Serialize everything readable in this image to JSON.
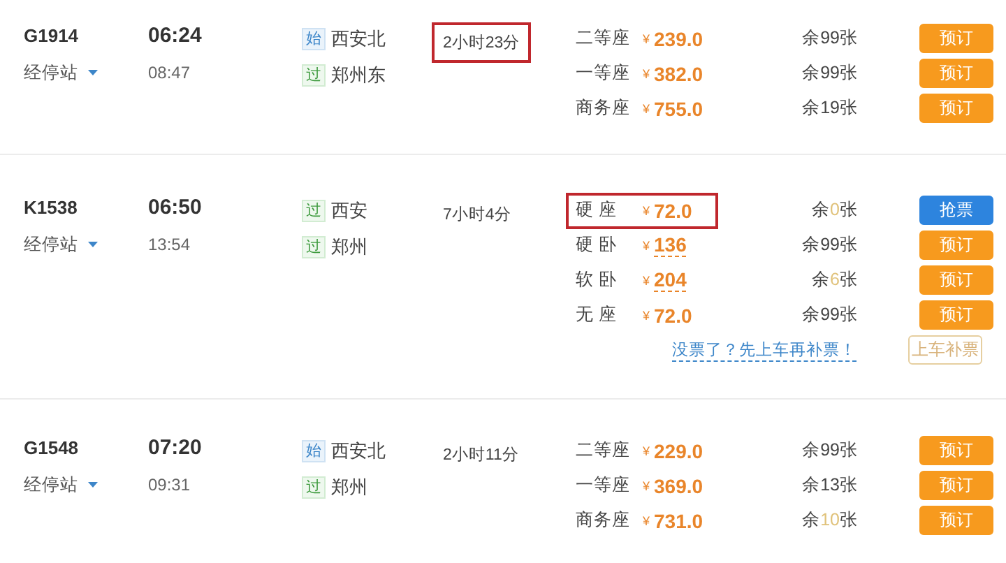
{
  "trains": [
    {
      "number": "G1914",
      "stops_label": "经停站",
      "depart": "06:24",
      "arrive": "08:47",
      "stations": [
        {
          "badge": "始",
          "kind": "start",
          "name": "西安北"
        },
        {
          "badge": "过",
          "kind": "pass",
          "name": "郑州东"
        }
      ],
      "duration": "2小时23分",
      "duration_highlighted": true,
      "seats": [
        {
          "name": "二等座",
          "currency": "¥",
          "price": "239.0",
          "underlined": false,
          "highlighted": false,
          "remaining": {
            "prefix": "余",
            "count": "99",
            "suffix": "张",
            "low": false
          },
          "button": {
            "label": "预订",
            "kind": "book"
          }
        },
        {
          "name": "一等座",
          "currency": "¥",
          "price": "382.0",
          "underlined": false,
          "highlighted": false,
          "remaining": {
            "prefix": "余",
            "count": "99",
            "suffix": "张",
            "low": false
          },
          "button": {
            "label": "预订",
            "kind": "book"
          }
        },
        {
          "name": "商务座",
          "currency": "¥",
          "price": "755.0",
          "underlined": false,
          "highlighted": false,
          "remaining": {
            "prefix": "余",
            "count": "19",
            "suffix": "张",
            "low": false
          },
          "button": {
            "label": "预订",
            "kind": "book"
          }
        }
      ]
    },
    {
      "number": "K1538",
      "stops_label": "经停站",
      "depart": "06:50",
      "arrive": "13:54",
      "stations": [
        {
          "badge": "过",
          "kind": "pass",
          "name": "西安"
        },
        {
          "badge": "过",
          "kind": "pass",
          "name": "郑州"
        }
      ],
      "duration": "7小时4分",
      "duration_highlighted": false,
      "seats": [
        {
          "name": "硬 座",
          "currency": "¥",
          "price": "72.0",
          "underlined": false,
          "highlighted": true,
          "remaining": {
            "prefix": "余",
            "count": "0",
            "suffix": "张",
            "low": true
          },
          "button": {
            "label": "抢票",
            "kind": "grab"
          }
        },
        {
          "name": "硬 卧",
          "currency": "¥",
          "price": "136",
          "underlined": true,
          "highlighted": false,
          "remaining": {
            "prefix": "余",
            "count": "99",
            "suffix": "张",
            "low": false
          },
          "button": {
            "label": "预订",
            "kind": "book"
          }
        },
        {
          "name": "软 卧",
          "currency": "¥",
          "price": "204",
          "underlined": true,
          "highlighted": false,
          "remaining": {
            "prefix": "余",
            "count": "6",
            "suffix": "张",
            "low": true
          },
          "button": {
            "label": "预订",
            "kind": "book"
          }
        },
        {
          "name": "无 座",
          "currency": "¥",
          "price": "72.0",
          "underlined": false,
          "highlighted": false,
          "remaining": {
            "prefix": "余",
            "count": "99",
            "suffix": "张",
            "low": false
          },
          "button": {
            "label": "预订",
            "kind": "book"
          }
        }
      ],
      "extra": {
        "link": "没票了？先上车再补票！",
        "button": {
          "label": "上车补票",
          "kind": "board"
        }
      }
    },
    {
      "number": "G1548",
      "stops_label": "经停站",
      "depart": "07:20",
      "arrive": "09:31",
      "stations": [
        {
          "badge": "始",
          "kind": "start",
          "name": "西安北"
        },
        {
          "badge": "过",
          "kind": "pass",
          "name": "郑州"
        }
      ],
      "duration": "2小时11分",
      "duration_highlighted": false,
      "seats": [
        {
          "name": "二等座",
          "currency": "¥",
          "price": "229.0",
          "underlined": false,
          "highlighted": false,
          "remaining": {
            "prefix": "余",
            "count": "99",
            "suffix": "张",
            "low": false
          },
          "button": {
            "label": "预订",
            "kind": "book"
          }
        },
        {
          "name": "一等座",
          "currency": "¥",
          "price": "369.0",
          "underlined": false,
          "highlighted": false,
          "remaining": {
            "prefix": "余",
            "count": "13",
            "suffix": "张",
            "low": false
          },
          "button": {
            "label": "预订",
            "kind": "book"
          }
        },
        {
          "name": "商务座",
          "currency": "¥",
          "price": "731.0",
          "underlined": false,
          "highlighted": false,
          "remaining": {
            "prefix": "余",
            "count": "10",
            "suffix": "张",
            "low": true
          },
          "button": {
            "label": "预订",
            "kind": "book"
          }
        }
      ]
    }
  ]
}
